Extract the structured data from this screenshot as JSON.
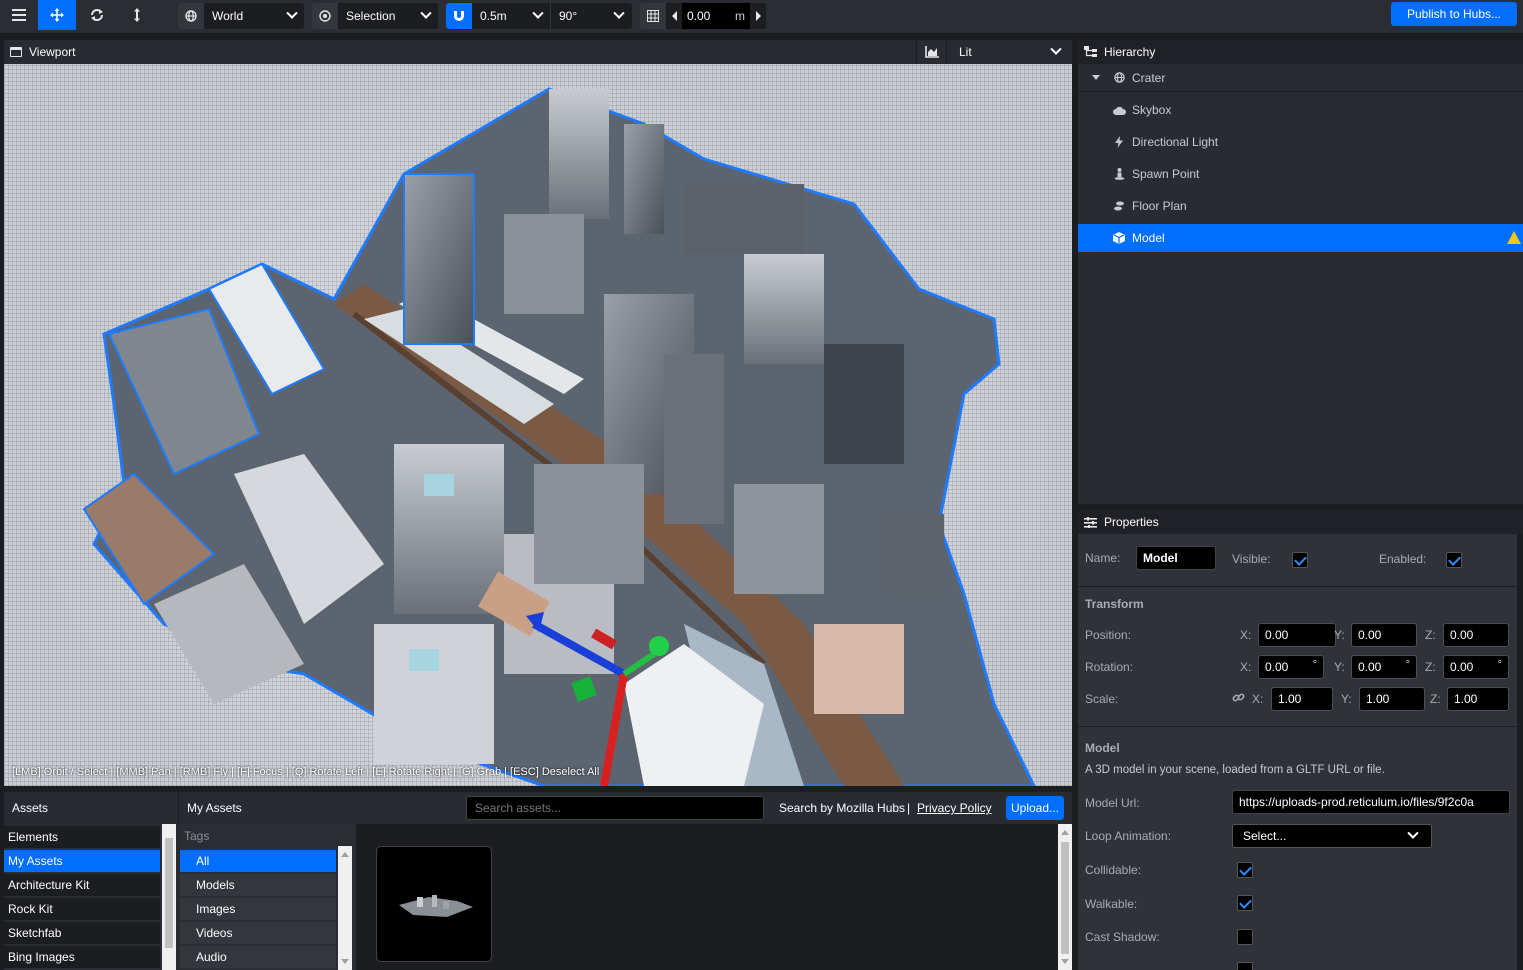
{
  "toolbar": {
    "space_select": "World",
    "pivot_select": "Selection",
    "snap_translate": "0.5m",
    "snap_rotate": "90°",
    "grid_height": "0.00",
    "grid_unit": "m",
    "publish_label": "Publish to Hubs..."
  },
  "viewport": {
    "title": "Viewport",
    "render_mode": "Lit",
    "controls_hint": "[LMB] Orbit / Select | [MMB] Pan | [RMB] Fly | [F] Focus | [Q] Rotate Left | [E] Rotate Right | [G] Grab | [ESC] Deselect All"
  },
  "hierarchy": {
    "title": "Hierarchy",
    "root": "Crater",
    "items": [
      {
        "label": "Skybox",
        "icon": "cloud-icon"
      },
      {
        "label": "Directional Light",
        "icon": "bolt-icon"
      },
      {
        "label": "Spawn Point",
        "icon": "street-view-icon"
      },
      {
        "label": "Floor Plan",
        "icon": "shoe-prints-icon"
      },
      {
        "label": "Model",
        "icon": "cube-icon",
        "selected": true,
        "warning": true
      }
    ]
  },
  "properties": {
    "title": "Properties",
    "name_label": "Name:",
    "name_value": "Model",
    "visible_label": "Visible:",
    "visible": true,
    "enabled_label": "Enabled:",
    "enabled": true,
    "transform_title": "Transform",
    "position_label": "Position:",
    "rotation_label": "Rotation:",
    "scale_label": "Scale:",
    "position": {
      "x": "0.00",
      "y": "0.00",
      "z": "0.00"
    },
    "rotation": {
      "x": "0.00",
      "y": "0.00",
      "z": "0.00",
      "unit": "°"
    },
    "scale": {
      "x": "1.00",
      "y": "1.00",
      "z": "1.00"
    },
    "axis_x": "X:",
    "axis_y": "Y:",
    "axis_z": "Z:",
    "model_title": "Model",
    "model_description": "A 3D model in your scene, loaded from a GLTF URL or file.",
    "model_url_label": "Model Url:",
    "model_url": "https://uploads-prod.reticulum.io/files/9f2c0a",
    "loop_animation_label": "Loop Animation:",
    "loop_animation_value": "Select...",
    "collidable_label": "Collidable:",
    "collidable": true,
    "walkable_label": "Walkable:",
    "walkable": true,
    "cast_shadow_label": "Cast Shadow:",
    "cast_shadow": false
  },
  "assets": {
    "title": "Assets",
    "source_title": "My Assets",
    "search_placeholder": "Search assets...",
    "search_by": "Search by Mozilla Hubs",
    "separator": "|",
    "privacy_policy": "Privacy Policy",
    "upload_label": "Upload...",
    "sources": [
      "Elements",
      "My Assets",
      "Architecture Kit",
      "Rock Kit",
      "Sketchfab",
      "Bing Images"
    ],
    "selected_source": 1,
    "tags_title": "Tags",
    "tags": [
      "All",
      "Models",
      "Images",
      "Videos",
      "Audio"
    ],
    "selected_tag": 0
  },
  "colors": {
    "accent": "#006eff",
    "panel": "#282b31",
    "background": "#1b1d21",
    "warning": "#f5c518",
    "selection_outline": "#1e7bff"
  }
}
